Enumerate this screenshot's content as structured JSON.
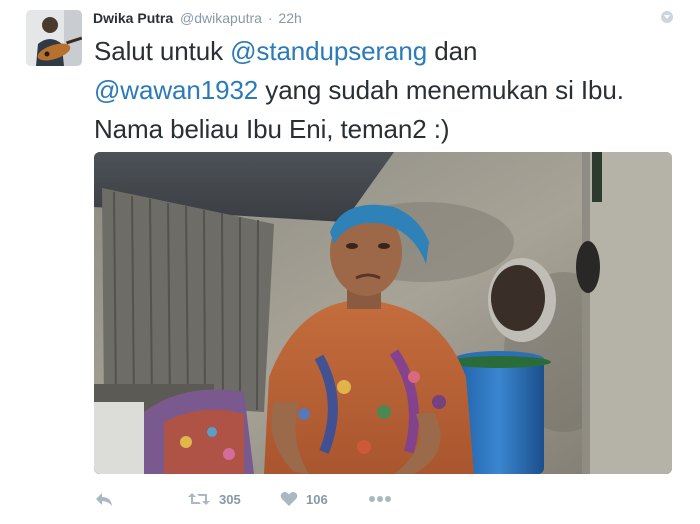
{
  "tweet": {
    "author_name": "Dwika Putra",
    "author_handle": "@dwikaputra",
    "separator": "·",
    "timestamp": "22h",
    "text": {
      "part1": "Salut untuk ",
      "mention1": "@standupserang",
      "part2": " dan ",
      "mention2": "@wawan1932",
      "part3": " yang sudah menemukan si Ibu. Nama beliau Ibu Eni, teman2 :)"
    },
    "media": {
      "description_icon": "photo"
    }
  },
  "actions": {
    "reply_icon": "reply-icon",
    "retweet_icon": "retweet-icon",
    "retweet_count": "305",
    "like_icon": "heart-icon",
    "like_count": "106",
    "more_icon": "more-icon"
  },
  "colors": {
    "link": "#2b7bb9",
    "muted": "#8899a6",
    "text": "#292f33",
    "icon": "#aab8c2"
  }
}
